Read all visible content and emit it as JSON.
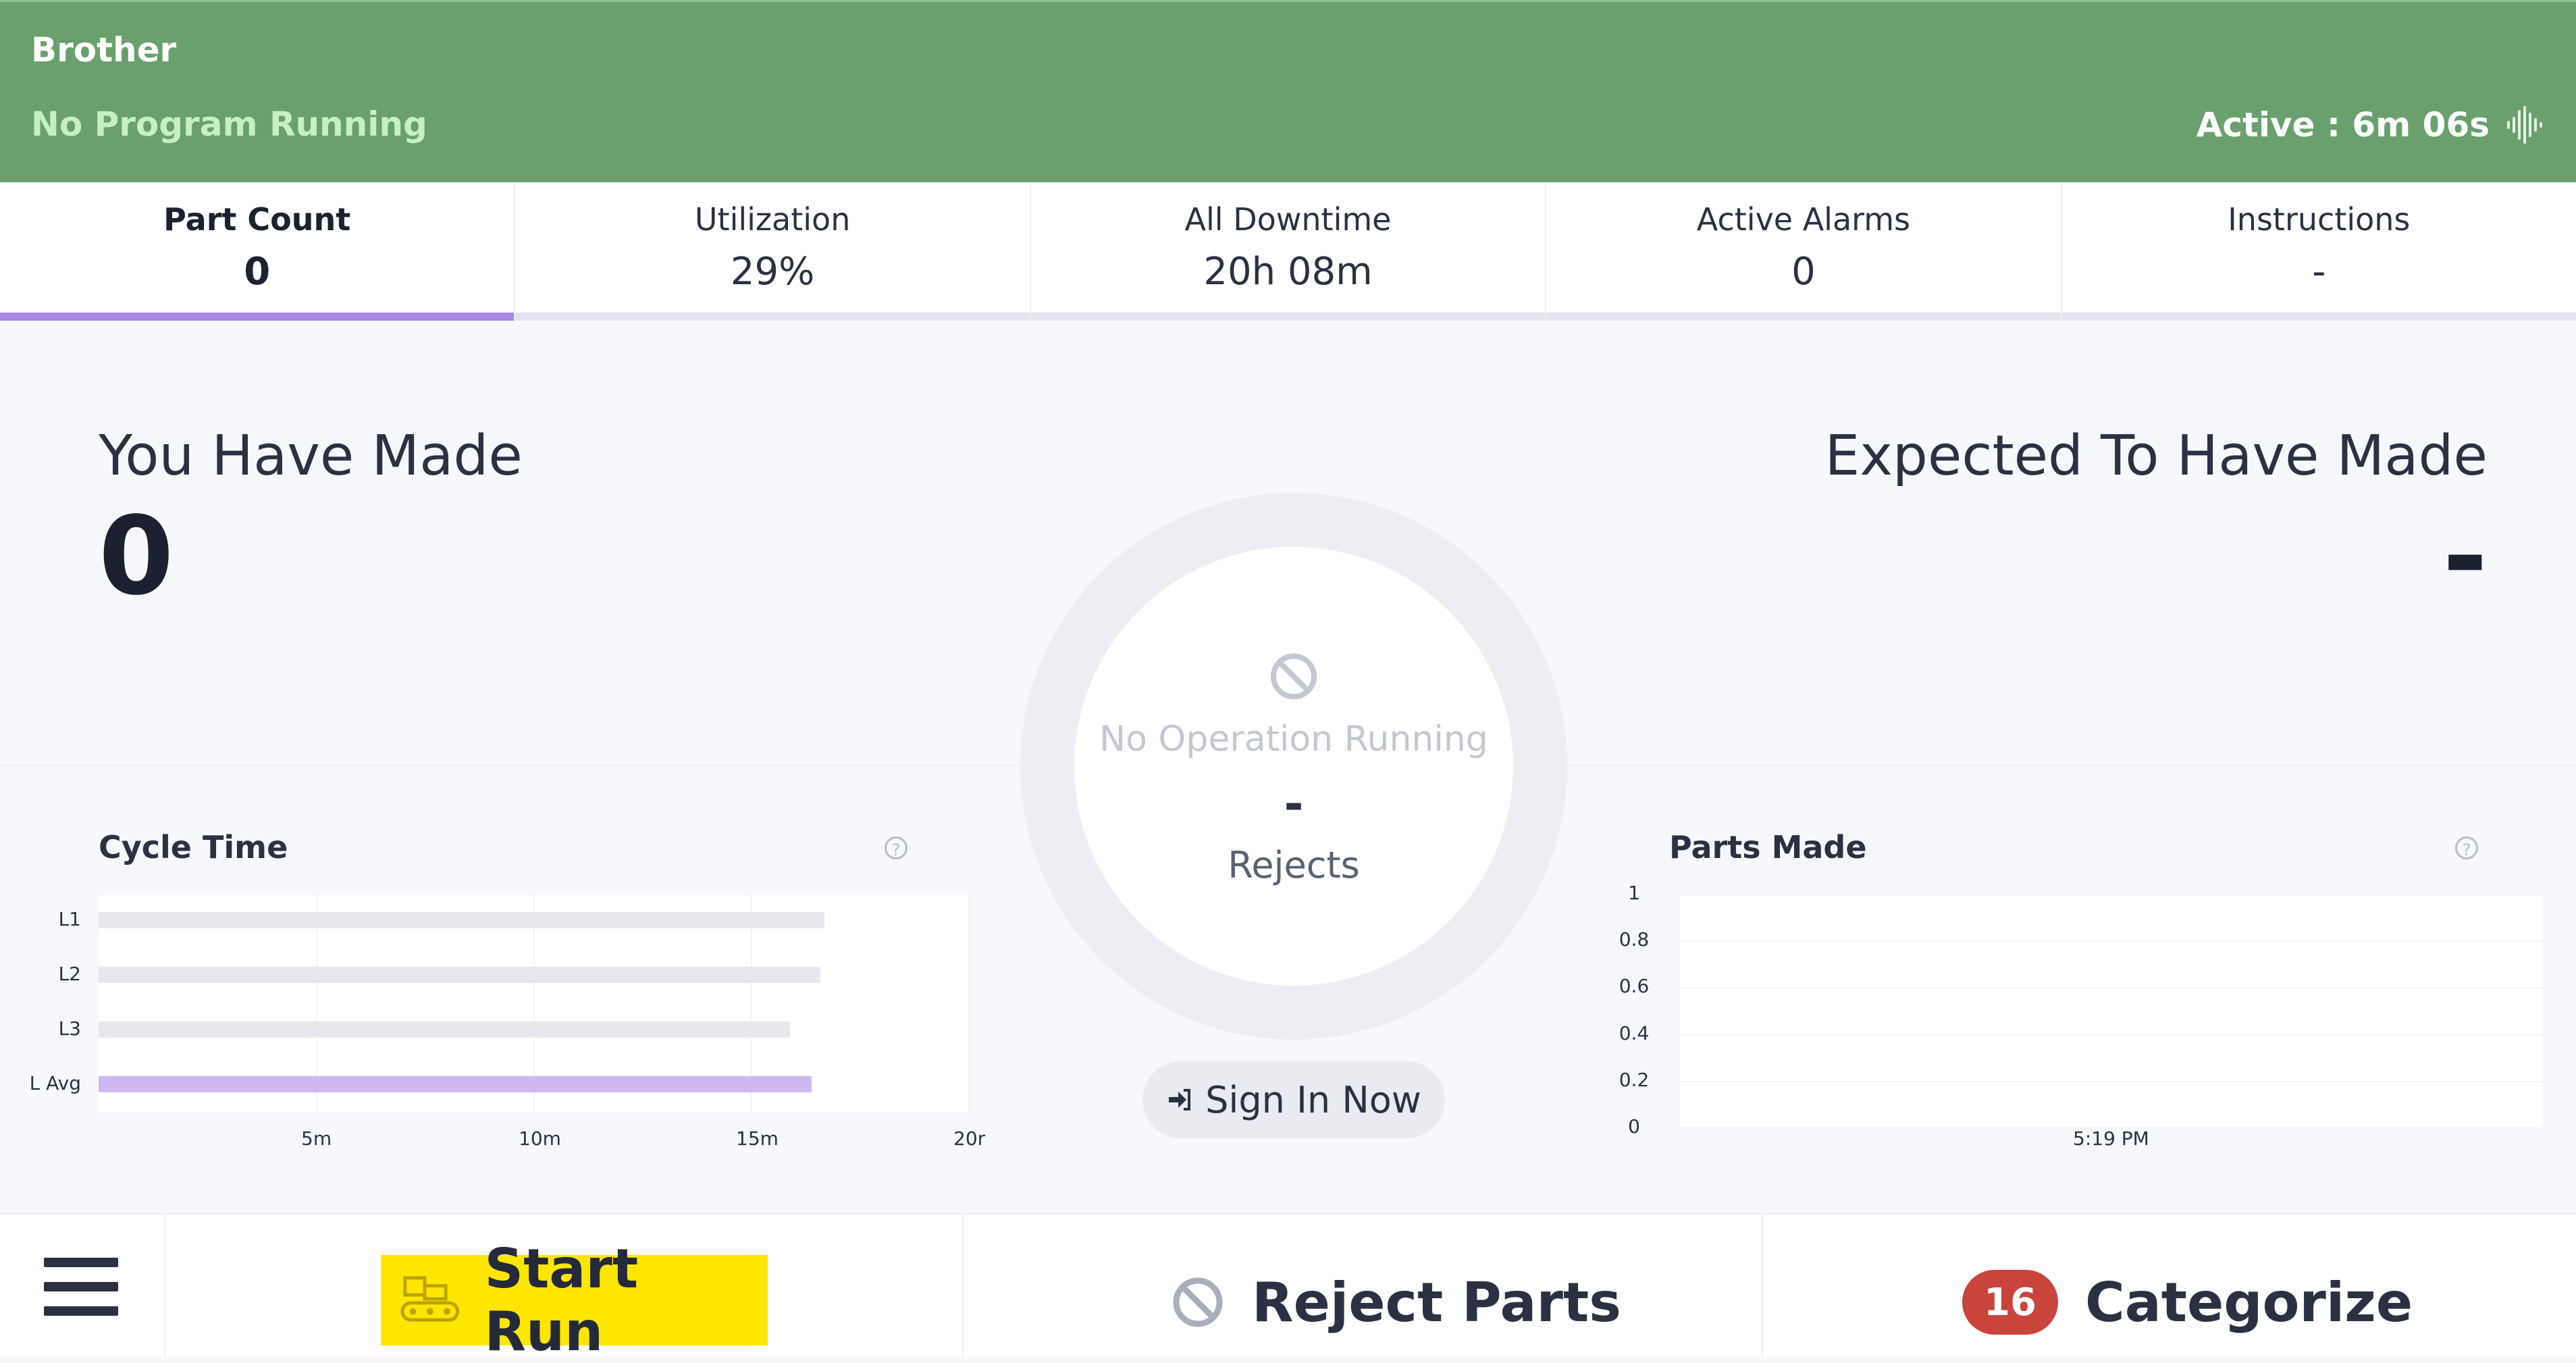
{
  "header": {
    "machine_name": "Brother",
    "program_status": "No Program Running",
    "active_status": "Active : 6m 06s",
    "background_color": "#69a06d"
  },
  "tabs": [
    {
      "label": "Part Count",
      "value": "0",
      "active": true
    },
    {
      "label": "Utilization",
      "value": "29%",
      "active": false
    },
    {
      "label": "All Downtime",
      "value": "20h 08m",
      "active": false
    },
    {
      "label": "Active Alarms",
      "value": "0",
      "active": false
    },
    {
      "label": "Instructions",
      "value": "-",
      "active": false
    }
  ],
  "main": {
    "made_label": "You Have Made",
    "made_value": "0",
    "expected_label": "Expected To Have Made",
    "expected_value": "-",
    "ring_status": "No Operation Running",
    "ring_value": "-",
    "ring_sub": "Rejects",
    "signin_label": "Sign In Now"
  },
  "chart_data": [
    {
      "type": "bar",
      "orientation": "horizontal",
      "title": "Cycle Time",
      "categories": [
        "L1",
        "L2",
        "L3",
        "L Avg"
      ],
      "values": [
        16.7,
        16.6,
        15.9,
        16.4
      ],
      "unit": "minutes",
      "x_ticks": [
        "5m",
        "10m",
        "15m",
        "20r"
      ],
      "xlim": [
        0,
        20
      ],
      "colors": [
        "#e6e8ee",
        "#e6e8ee",
        "#e6e8ee",
        "#cdb9f0"
      ]
    },
    {
      "type": "line",
      "title": "Parts Made",
      "x": [
        "5:19 PM"
      ],
      "y_ticks": [
        "1",
        "0.8",
        "0.6",
        "0.4",
        "0.2",
        "0"
      ],
      "ylim": [
        0,
        1
      ],
      "series": []
    }
  ],
  "bottom": {
    "start_run_label": "Start Run",
    "reject_label": "Reject Parts",
    "categorize_label": "Categorize",
    "categorize_count": "16",
    "accent_yellow": "#ffe600",
    "badge_color": "#c8443d"
  }
}
